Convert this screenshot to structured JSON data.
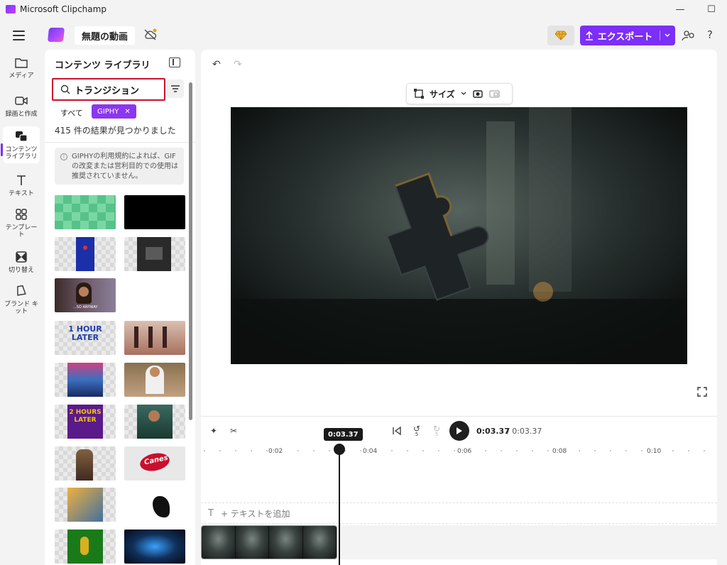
{
  "window": {
    "title": "Microsoft Clipchamp",
    "minimize": "—",
    "maximize": "☐"
  },
  "appbar": {
    "project_title": "無題の動画",
    "export_label": "エクスポート",
    "help": "?"
  },
  "nav": {
    "items": [
      {
        "label": "メディア",
        "icon": "folder-icon"
      },
      {
        "label": "録画と作成",
        "icon": "camera-icon"
      },
      {
        "label": "コンテンツ ライブラリ",
        "icon": "content-library-icon",
        "active": true
      },
      {
        "label": "テキスト",
        "icon": "text-icon"
      },
      {
        "label": "テンプレート",
        "icon": "template-icon"
      },
      {
        "label": "切り替え",
        "icon": "transition-icon"
      },
      {
        "label": "ブランド キット",
        "icon": "brand-kit-icon"
      }
    ]
  },
  "library": {
    "title": "コンテンツ ライブラリ",
    "search_value": "トランジション",
    "filter_all": "すべて",
    "filter_giphy": "GIPHY",
    "result_count": "415 件の結果が見つかりました",
    "notice": "GIPHYの利用規約によれば、GIF の改変または営利目的での使用は推奨されていません。",
    "thumbs": [
      {
        "name": "gif-green-checker"
      },
      {
        "name": "gif-black"
      },
      {
        "name": "gif-blue-panel"
      },
      {
        "name": "gif-dark-scene"
      },
      {
        "name": "gif-woman-talking",
        "caption": "...SO ANYWAY"
      },
      {
        "name": "gif-1-hour-later",
        "text": "1 HOUR LATER"
      },
      {
        "name": "gif-dancers"
      },
      {
        "name": "gif-colorful-hall"
      },
      {
        "name": "gif-woman-tv-show"
      },
      {
        "name": "gif-2-hours-later",
        "text": "2 HOURS LATER"
      },
      {
        "name": "gif-woman-smiling"
      },
      {
        "name": "gif-man-standing"
      },
      {
        "name": "gif-canes-logo",
        "text": "Canes"
      },
      {
        "name": "gif-guitar-player"
      },
      {
        "name": "gif-silhouette"
      },
      {
        "name": "gif-dancing-figure"
      },
      {
        "name": "gif-blue-light"
      }
    ]
  },
  "editor": {
    "size_label": "サイズ"
  },
  "timeline": {
    "current_time": "0:03.37",
    "total_time": "/ 0:03.37",
    "playhead_label": "0:03.37",
    "ruler": [
      "0:02",
      "0:04",
      "0:06",
      "0:08",
      "0:10"
    ],
    "add_text": "+ テキストを追加",
    "skip_back": "5",
    "skip_forward": "5"
  },
  "colors": {
    "accent": "#7b2ff7",
    "search_highlight": "#c8102e"
  }
}
